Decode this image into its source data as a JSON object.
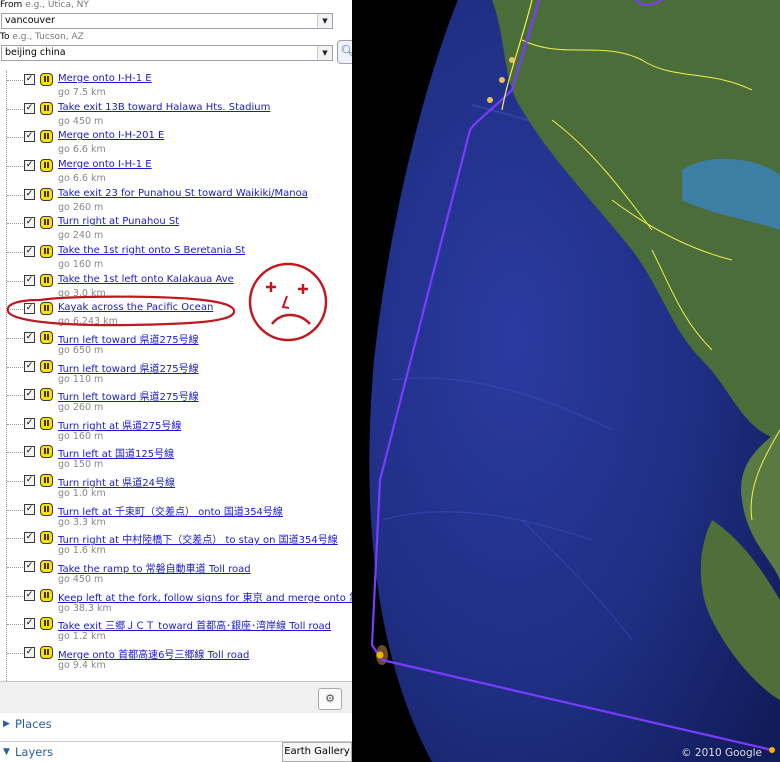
{
  "directions_form": {
    "from_label": "From",
    "from_example": "e.g., Utica, NY",
    "from_value": "vancouver",
    "to_label": "To",
    "to_example": "e.g., Tucson, AZ",
    "to_value": "beijing china",
    "go_icon": "search-icon"
  },
  "steps": [
    {
      "text": "Merge onto I-H-1 E",
      "distance": "go 7.5 km"
    },
    {
      "text": "Take exit 13B toward Halawa Hts. Stadium",
      "distance": "go 450 m"
    },
    {
      "text": "Merge onto I-H-201 E",
      "distance": "go 6.6 km"
    },
    {
      "text": "Merge onto I-H-1 E",
      "distance": "go 6.6 km"
    },
    {
      "text": "Take exit 23 for Punahou St toward Waikiki/Manoa",
      "distance": "go 260 m"
    },
    {
      "text": "Turn right at Punahou St",
      "distance": "go 240 m"
    },
    {
      "text": "Take the 1st right onto S Beretania St",
      "distance": "go 160 m"
    },
    {
      "text": "Take the 1st left onto Kalakaua Ave",
      "distance": "go 3.0 km"
    },
    {
      "text": "Kayak across the Pacific Ocean",
      "distance": "go 6,243 km"
    },
    {
      "text": "Turn left toward 県道275号線",
      "distance": "go 650 m"
    },
    {
      "text": "Turn left toward 県道275号線",
      "distance": "go 110 m"
    },
    {
      "text": "Turn left toward 県道275号線",
      "distance": "go 260 m"
    },
    {
      "text": "Turn right at 県道275号線",
      "distance": "go 160 m"
    },
    {
      "text": "Turn left at 国道125号線",
      "distance": "go 150 m"
    },
    {
      "text": "Turn right at 県道24号線",
      "distance": "go 1.0 km"
    },
    {
      "text": "Turn left at 千束町（交差点） onto 国道354号線",
      "distance": "go 3.3 km"
    },
    {
      "text": "Turn right at 中村陸橋下（交差点） to stay on 国道354号線",
      "distance": "go 1.6 km"
    },
    {
      "text": "Take the ramp to 常磐自動車道 Toll road",
      "distance": "go 450 m"
    },
    {
      "text": "Keep left at the fork, follow signs for 東京 and merge onto 常磐自",
      "distance": "go 38.3 km"
    },
    {
      "text": "Take exit 三郷ＪＣＴ toward 首都高･銀座･湾岸線 Toll road",
      "distance": "go 1.2 km"
    },
    {
      "text": "Merge onto 首都高速6号三郷線 Toll road",
      "distance": "go 9.4 km"
    }
  ],
  "step_icons": {
    "checkbox_mark": "✓",
    "pin_glyph": "II"
  },
  "panels": {
    "places": "Places",
    "layers": "Layers",
    "gallery": "Earth Gallery"
  },
  "map": {
    "copyright": "© 2010 Google",
    "route_color": "#7a3cff",
    "border_color": "#f5f04a",
    "annotation_color": "#c0181f"
  }
}
